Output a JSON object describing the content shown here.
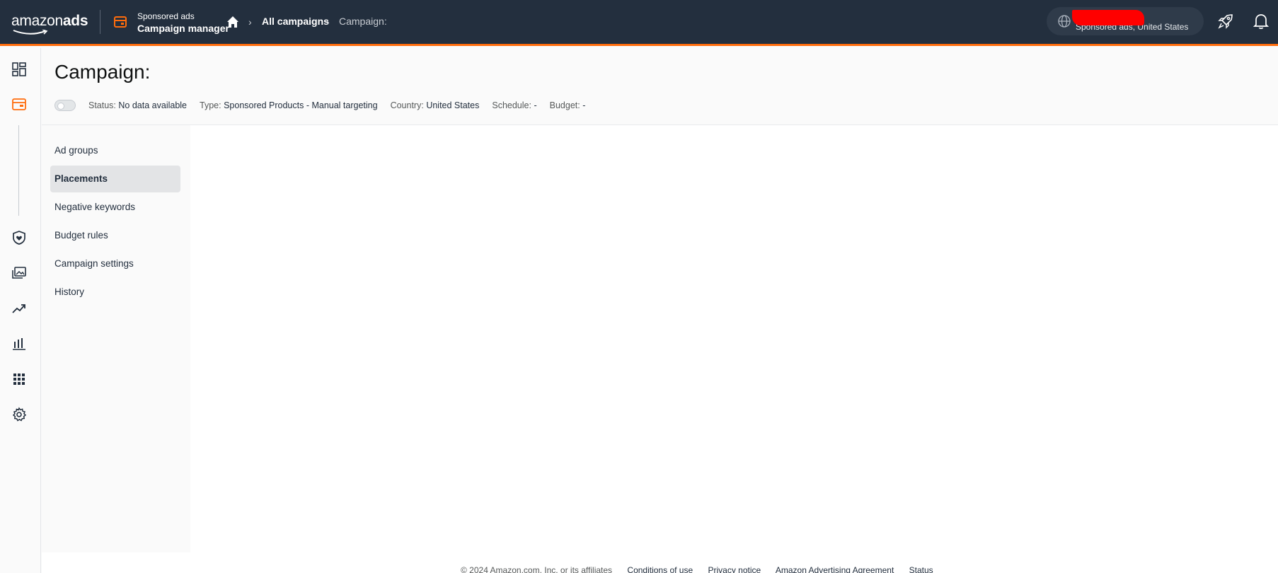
{
  "header": {
    "logo_main": "amazon",
    "logo_suffix": "ads",
    "product_line": "Sponsored ads",
    "product_name": "Campaign manager",
    "breadcrumb": {
      "all_campaigns": "All campaigns",
      "current": "Campaign:"
    },
    "account": {
      "subtitle": "Sponsored ads, United States"
    }
  },
  "rail": {
    "items": [
      "dashboard-icon",
      "campaign-manager-icon",
      "brand-protection-icon",
      "creative-assets-icon",
      "measurement-icon",
      "reports-icon",
      "apps-icon",
      "settings-icon"
    ],
    "accent_color": "#ff6c0c"
  },
  "page": {
    "title": "Campaign:",
    "meta": {
      "status_label": "Status:",
      "status_value": "No data available",
      "type_label": "Type:",
      "type_value": "Sponsored Products - Manual targeting",
      "country_label": "Country:",
      "country_value": "United States",
      "schedule_label": "Schedule:",
      "schedule_value": "-",
      "budget_label": "Budget:",
      "budget_value": "-"
    }
  },
  "subnav": {
    "items": [
      {
        "label": "Ad groups"
      },
      {
        "label": "Placements"
      },
      {
        "label": "Negative keywords"
      },
      {
        "label": "Budget rules"
      },
      {
        "label": "Campaign settings"
      },
      {
        "label": "History"
      }
    ],
    "active": "Placements"
  },
  "footer": {
    "copyright": "© 2024 Amazon.com, Inc. or its affiliates",
    "links": [
      "Conditions of use",
      "Privacy notice",
      "Amazon Advertising Agreement",
      "Status"
    ]
  },
  "colors": {
    "header_bg": "#232f3e",
    "accent": "#ff6c0c",
    "redaction": "#ff0000"
  }
}
